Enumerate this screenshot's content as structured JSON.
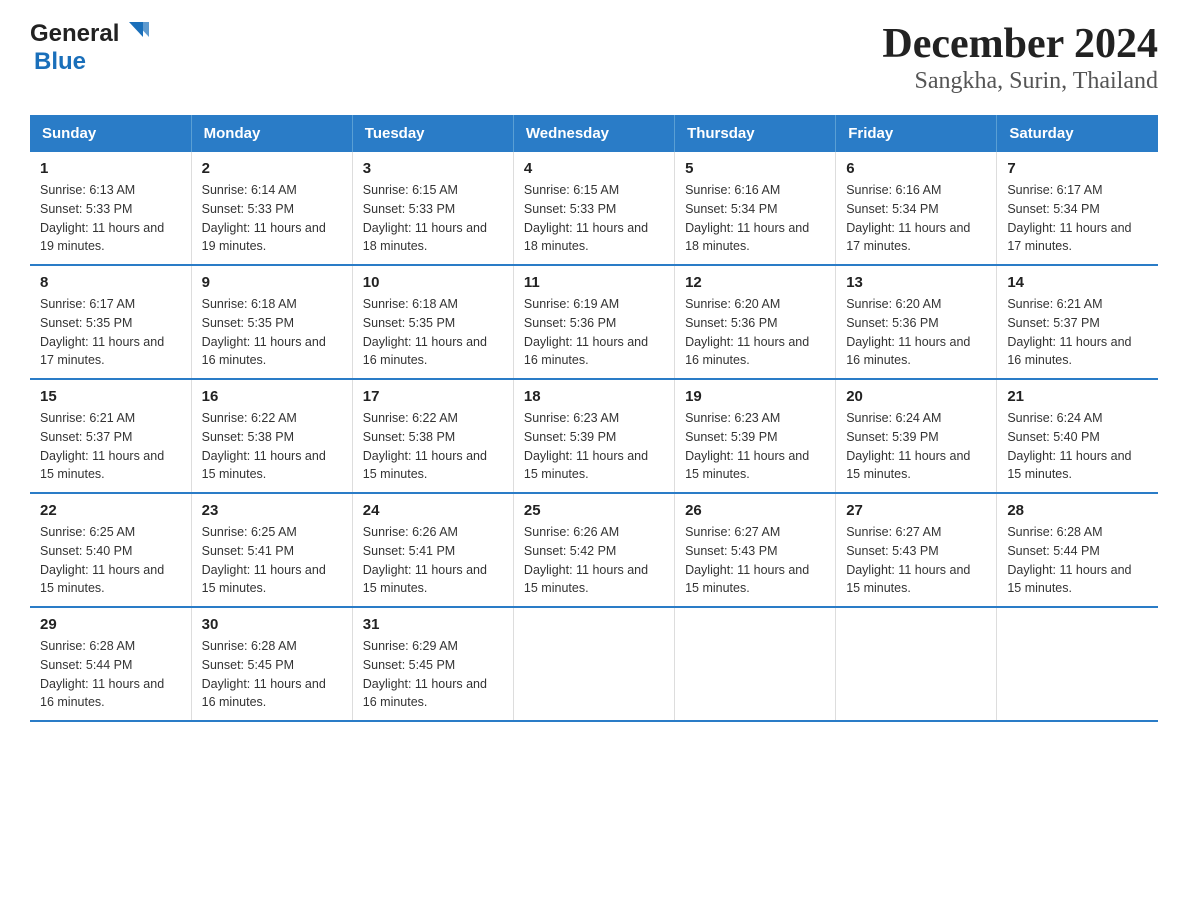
{
  "header": {
    "title": "December 2024",
    "subtitle": "Sangkha, Surin, Thailand",
    "logo_general": "General",
    "logo_blue": "Blue"
  },
  "weekdays": [
    "Sunday",
    "Monday",
    "Tuesday",
    "Wednesday",
    "Thursday",
    "Friday",
    "Saturday"
  ],
  "weeks": [
    [
      {
        "day": "1",
        "sunrise": "6:13 AM",
        "sunset": "5:33 PM",
        "daylight": "11 hours and 19 minutes."
      },
      {
        "day": "2",
        "sunrise": "6:14 AM",
        "sunset": "5:33 PM",
        "daylight": "11 hours and 19 minutes."
      },
      {
        "day": "3",
        "sunrise": "6:15 AM",
        "sunset": "5:33 PM",
        "daylight": "11 hours and 18 minutes."
      },
      {
        "day": "4",
        "sunrise": "6:15 AM",
        "sunset": "5:33 PM",
        "daylight": "11 hours and 18 minutes."
      },
      {
        "day": "5",
        "sunrise": "6:16 AM",
        "sunset": "5:34 PM",
        "daylight": "11 hours and 18 minutes."
      },
      {
        "day": "6",
        "sunrise": "6:16 AM",
        "sunset": "5:34 PM",
        "daylight": "11 hours and 17 minutes."
      },
      {
        "day": "7",
        "sunrise": "6:17 AM",
        "sunset": "5:34 PM",
        "daylight": "11 hours and 17 minutes."
      }
    ],
    [
      {
        "day": "8",
        "sunrise": "6:17 AM",
        "sunset": "5:35 PM",
        "daylight": "11 hours and 17 minutes."
      },
      {
        "day": "9",
        "sunrise": "6:18 AM",
        "sunset": "5:35 PM",
        "daylight": "11 hours and 16 minutes."
      },
      {
        "day": "10",
        "sunrise": "6:18 AM",
        "sunset": "5:35 PM",
        "daylight": "11 hours and 16 minutes."
      },
      {
        "day": "11",
        "sunrise": "6:19 AM",
        "sunset": "5:36 PM",
        "daylight": "11 hours and 16 minutes."
      },
      {
        "day": "12",
        "sunrise": "6:20 AM",
        "sunset": "5:36 PM",
        "daylight": "11 hours and 16 minutes."
      },
      {
        "day": "13",
        "sunrise": "6:20 AM",
        "sunset": "5:36 PM",
        "daylight": "11 hours and 16 minutes."
      },
      {
        "day": "14",
        "sunrise": "6:21 AM",
        "sunset": "5:37 PM",
        "daylight": "11 hours and 16 minutes."
      }
    ],
    [
      {
        "day": "15",
        "sunrise": "6:21 AM",
        "sunset": "5:37 PM",
        "daylight": "11 hours and 15 minutes."
      },
      {
        "day": "16",
        "sunrise": "6:22 AM",
        "sunset": "5:38 PM",
        "daylight": "11 hours and 15 minutes."
      },
      {
        "day": "17",
        "sunrise": "6:22 AM",
        "sunset": "5:38 PM",
        "daylight": "11 hours and 15 minutes."
      },
      {
        "day": "18",
        "sunrise": "6:23 AM",
        "sunset": "5:39 PM",
        "daylight": "11 hours and 15 minutes."
      },
      {
        "day": "19",
        "sunrise": "6:23 AM",
        "sunset": "5:39 PM",
        "daylight": "11 hours and 15 minutes."
      },
      {
        "day": "20",
        "sunrise": "6:24 AM",
        "sunset": "5:39 PM",
        "daylight": "11 hours and 15 minutes."
      },
      {
        "day": "21",
        "sunrise": "6:24 AM",
        "sunset": "5:40 PM",
        "daylight": "11 hours and 15 minutes."
      }
    ],
    [
      {
        "day": "22",
        "sunrise": "6:25 AM",
        "sunset": "5:40 PM",
        "daylight": "11 hours and 15 minutes."
      },
      {
        "day": "23",
        "sunrise": "6:25 AM",
        "sunset": "5:41 PM",
        "daylight": "11 hours and 15 minutes."
      },
      {
        "day": "24",
        "sunrise": "6:26 AM",
        "sunset": "5:41 PM",
        "daylight": "11 hours and 15 minutes."
      },
      {
        "day": "25",
        "sunrise": "6:26 AM",
        "sunset": "5:42 PM",
        "daylight": "11 hours and 15 minutes."
      },
      {
        "day": "26",
        "sunrise": "6:27 AM",
        "sunset": "5:43 PM",
        "daylight": "11 hours and 15 minutes."
      },
      {
        "day": "27",
        "sunrise": "6:27 AM",
        "sunset": "5:43 PM",
        "daylight": "11 hours and 15 minutes."
      },
      {
        "day": "28",
        "sunrise": "6:28 AM",
        "sunset": "5:44 PM",
        "daylight": "11 hours and 15 minutes."
      }
    ],
    [
      {
        "day": "29",
        "sunrise": "6:28 AM",
        "sunset": "5:44 PM",
        "daylight": "11 hours and 16 minutes."
      },
      {
        "day": "30",
        "sunrise": "6:28 AM",
        "sunset": "5:45 PM",
        "daylight": "11 hours and 16 minutes."
      },
      {
        "day": "31",
        "sunrise": "6:29 AM",
        "sunset": "5:45 PM",
        "daylight": "11 hours and 16 minutes."
      },
      {
        "day": "",
        "sunrise": "",
        "sunset": "",
        "daylight": ""
      },
      {
        "day": "",
        "sunrise": "",
        "sunset": "",
        "daylight": ""
      },
      {
        "day": "",
        "sunrise": "",
        "sunset": "",
        "daylight": ""
      },
      {
        "day": "",
        "sunrise": "",
        "sunset": "",
        "daylight": ""
      }
    ]
  ],
  "labels": {
    "sunrise_prefix": "Sunrise: ",
    "sunset_prefix": "Sunset: ",
    "daylight_prefix": "Daylight: "
  }
}
